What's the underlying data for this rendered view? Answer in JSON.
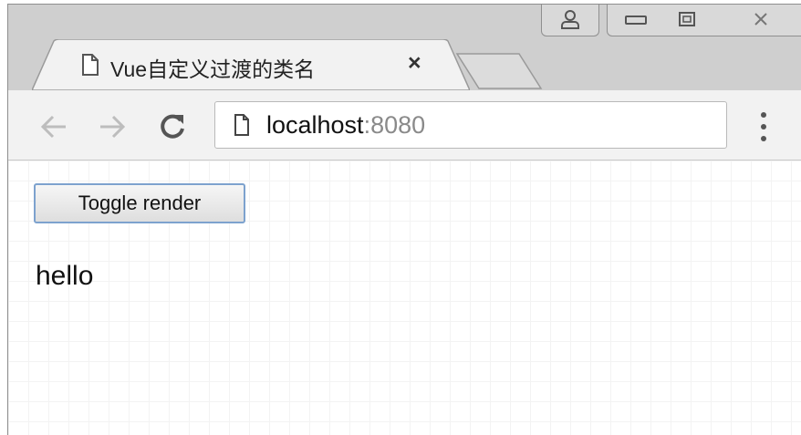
{
  "browser": {
    "tab": {
      "title": "Vue自定义过渡的类名",
      "close_label": "×"
    },
    "address": {
      "host": "localhost",
      "port": ":8080"
    }
  },
  "page": {
    "toggle_button_label": "Toggle render",
    "message": "hello"
  }
}
